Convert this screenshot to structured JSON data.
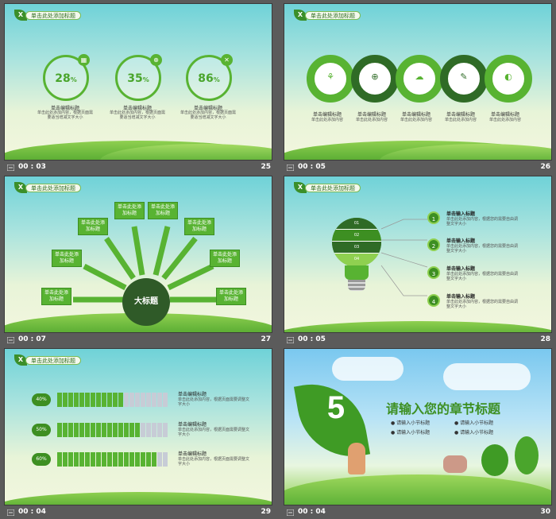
{
  "slides": [
    {
      "num": "25",
      "time": "00 : 03",
      "title": "单击此处添加标题",
      "leaf": "X",
      "items": [
        {
          "pct": "28",
          "unit": "%",
          "icon": "▦",
          "head": "单击编辑标题",
          "desc": "单击此处添加内容，根据页面需要适当增减文字大小"
        },
        {
          "pct": "35",
          "unit": "%",
          "icon": "⊕",
          "head": "单击编辑标题",
          "desc": "单击此处添加内容，根据页面需要适当增减文字大小"
        },
        {
          "pct": "86",
          "unit": "%",
          "icon": "✕",
          "head": "单击编辑标题",
          "desc": "单击此处添加内容，根据页面需要适当增减文字大小"
        }
      ]
    },
    {
      "num": "26",
      "time": "00 : 05",
      "title": "单击此处添加标题",
      "leaf": "X",
      "items": [
        {
          "icon": "⚘",
          "head": "单击编辑标题",
          "desc": "单击此处添加内容"
        },
        {
          "icon": "⊕",
          "head": "单击编辑标题",
          "desc": "单击此处添加内容"
        },
        {
          "icon": "☁",
          "head": "单击编辑标题",
          "desc": "单击此处添加内容"
        },
        {
          "icon": "✎",
          "head": "单击编辑标题",
          "desc": "单击此处添加内容"
        },
        {
          "icon": "◐",
          "head": "单击编辑标题",
          "desc": "单击此处添加内容"
        }
      ]
    },
    {
      "num": "27",
      "time": "00 : 07",
      "title": "单击此处添加标题",
      "leaf": "X",
      "hub": "大标题",
      "boxes": [
        "单击此处添加标题",
        "单击此处添加标题",
        "单击此处添加标题",
        "单击此处添加标题",
        "单击此处添加标题",
        "单击此处添加标题",
        "单击此处添加标题",
        "单击此处添加标题"
      ]
    },
    {
      "num": "28",
      "time": "00 : 05",
      "title": "单击此处添加标题",
      "leaf": "X",
      "bulb": [
        "01",
        "02",
        "03",
        "04"
      ],
      "items": [
        {
          "n": "1",
          "head": "单击输入标题",
          "desc": "单击此处添加内容，根据您的需要自由调整文字大小"
        },
        {
          "n": "2",
          "head": "单击输入标题",
          "desc": "单击此处添加内容，根据您的需要自由调整文字大小"
        },
        {
          "n": "3",
          "head": "单击输入标题",
          "desc": "单击此处添加内容，根据您的需要自由调整文字大小"
        },
        {
          "n": "4",
          "head": "单击输入标题",
          "desc": "单击此处添加内容，根据您的需要自由调整文字大小"
        }
      ]
    },
    {
      "num": "29",
      "time": "00 : 04",
      "title": "单击此处添加标题",
      "leaf": "X",
      "rows": [
        {
          "pct": "40%",
          "fill": 0.6,
          "head": "单击编辑标题",
          "desc": "单击此处添加内容，根据页面需要调整文字大小"
        },
        {
          "pct": "50%",
          "fill": 0.75,
          "head": "单击编辑标题",
          "desc": "单击此处添加内容，根据页面需要调整文字大小"
        },
        {
          "pct": "60%",
          "fill": 0.9,
          "head": "单击编辑标题",
          "desc": "单击此处添加内容，根据页面需要调整文字大小"
        }
      ]
    },
    {
      "num": "30",
      "time": "00 : 04",
      "chapter_num": "5",
      "chapter_title": "请输入您的章节标题",
      "subs": [
        "请输入小节标题",
        "请输入小节标题",
        "请输入小节标题",
        "请输入小节标题"
      ]
    }
  ]
}
